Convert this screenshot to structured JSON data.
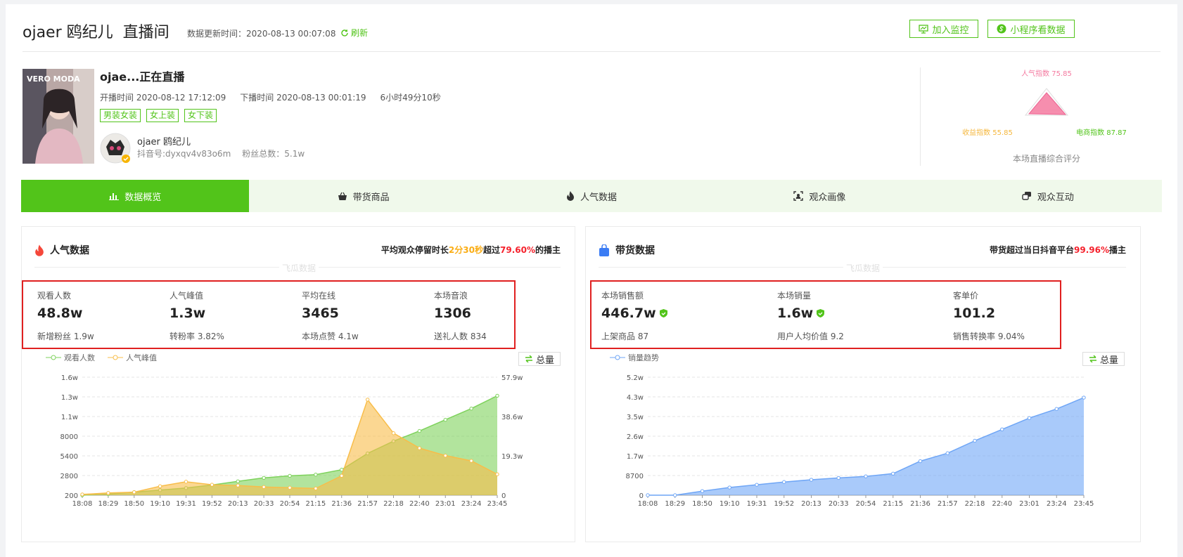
{
  "header": {
    "streamer": "ojaer 鸥纪儿",
    "page_title": "直播间",
    "update_label": "数据更新时间：2020-08-13 00:07:08",
    "refresh_label": "刷新",
    "add_monitor_label": "加入监控",
    "miniapp_label": "小程序看数据"
  },
  "live": {
    "title": "ojae...正在直播",
    "start_label": "开播时间 2020-08-12 17:12:09",
    "end_label": "下播时间 2020-08-13 00:01:19",
    "duration": "6小时49分10秒",
    "tags": [
      "男装女装",
      "女上装",
      "女下装"
    ],
    "avatar_brand": "VERO MODA",
    "author_name": "ojaer 鸥纪儿",
    "douyin_id": "抖音号:dyxqv4v83o6m",
    "fans": "粉丝总数：5.1w"
  },
  "radar": {
    "popularity": "人气指数 75.85",
    "revenue": "收益指数 55.85",
    "ecommerce": "电商指数 87.87",
    "caption": "本场直播综合评分",
    "colors": {
      "popularity": "#f47aa0",
      "revenue": "#f5b73d",
      "ecommerce": "#52c41a"
    }
  },
  "tabs": [
    {
      "label": "数据概览",
      "icon": "bar-chart-icon",
      "active": true
    },
    {
      "label": "带货商品",
      "icon": "basket-icon",
      "active": false
    },
    {
      "label": "人气数据",
      "icon": "flame-icon",
      "active": false
    },
    {
      "label": "观众画像",
      "icon": "face-scan-icon",
      "active": false
    },
    {
      "label": "观众互动",
      "icon": "chat-icon",
      "active": false
    }
  ],
  "popularity_panel": {
    "title": "人气数据",
    "note_prefix": "平均观众停留时长",
    "note_duration": "2分30秒",
    "note_mid": "超过",
    "note_pct": "79.60%",
    "note_suffix": "的播主",
    "watermark": "飞瓜数据",
    "stats": [
      {
        "label": "观看人数",
        "value": "48.8w",
        "sub": "新增粉丝 1.9w"
      },
      {
        "label": "人气峰值",
        "value": "1.3w",
        "sub": "转粉率 3.82%"
      },
      {
        "label": "平均在线",
        "value": "3465",
        "sub": "本场点赞 4.1w"
      },
      {
        "label": "本场音浪",
        "value": "1306",
        "sub": "送礼人数 834"
      }
    ],
    "total_label": "总量"
  },
  "sales_panel": {
    "title": "带货数据",
    "note_prefix": "带货超过当日抖音平台",
    "note_pct": "99.96%",
    "note_suffix": "播主",
    "watermark": "飞瓜数据",
    "stats": [
      {
        "label": "本场销售额",
        "value": "446.7w",
        "sub": "上架商品 87",
        "verified": true
      },
      {
        "label": "本场销量",
        "value": "1.6w",
        "sub": "用户人均价值 9.2",
        "verified": true
      },
      {
        "label": "客单价",
        "value": "101.2",
        "sub": "销售转换率 9.04%",
        "verified": false
      }
    ],
    "total_label": "总量"
  },
  "chart_data": [
    {
      "type": "area",
      "x": [
        "18:08",
        "18:29",
        "18:50",
        "19:10",
        "19:31",
        "19:52",
        "20:13",
        "20:33",
        "20:54",
        "21:15",
        "21:36",
        "21:57",
        "22:18",
        "22:40",
        "23:01",
        "23:24",
        "23:45"
      ],
      "yticks_left": [
        "200",
        "2800",
        "5400",
        "8000",
        "1.1w",
        "1.3w",
        "1.6w"
      ],
      "yticks_right": [
        "0",
        "19.3w",
        "38.6w",
        "57.9w"
      ],
      "ylim_left": [
        200,
        16000
      ],
      "ylim_right": [
        0,
        579000
      ],
      "series": [
        {
          "name": "观看人数",
          "axis": "right",
          "color": "#7ed25c",
          "values": [
            0,
            5000,
            15000,
            25000,
            35000,
            50000,
            68000,
            85000,
            95000,
            101000,
            125000,
            205000,
            265000,
            315000,
            370000,
            425000,
            488000
          ]
        },
        {
          "name": "人气峰值",
          "axis": "left",
          "color": "#f8bd49",
          "values": [
            300,
            500,
            600,
            1400,
            2000,
            1600,
            1500,
            1300,
            1200,
            1100,
            2800,
            13000,
            8500,
            6500,
            5500,
            4800,
            3000
          ]
        }
      ]
    },
    {
      "type": "area",
      "x": [
        "18:08",
        "18:29",
        "18:50",
        "19:10",
        "19:31",
        "19:52",
        "20:13",
        "20:33",
        "20:54",
        "21:15",
        "21:36",
        "21:57",
        "22:18",
        "22:40",
        "23:01",
        "23:24",
        "23:45"
      ],
      "yticks": [
        "0",
        "8700",
        "1.7w",
        "2.6w",
        "3.5w",
        "4.3w",
        "5.2w"
      ],
      "ylim": [
        0,
        52000
      ],
      "series": [
        {
          "name": "销量趋势",
          "color": "#6fa6f6",
          "values": [
            0,
            0,
            1800,
            3400,
            4600,
            5800,
            6800,
            7600,
            8300,
            9500,
            15000,
            18500,
            24000,
            29000,
            34000,
            38000,
            43000
          ]
        }
      ]
    }
  ]
}
